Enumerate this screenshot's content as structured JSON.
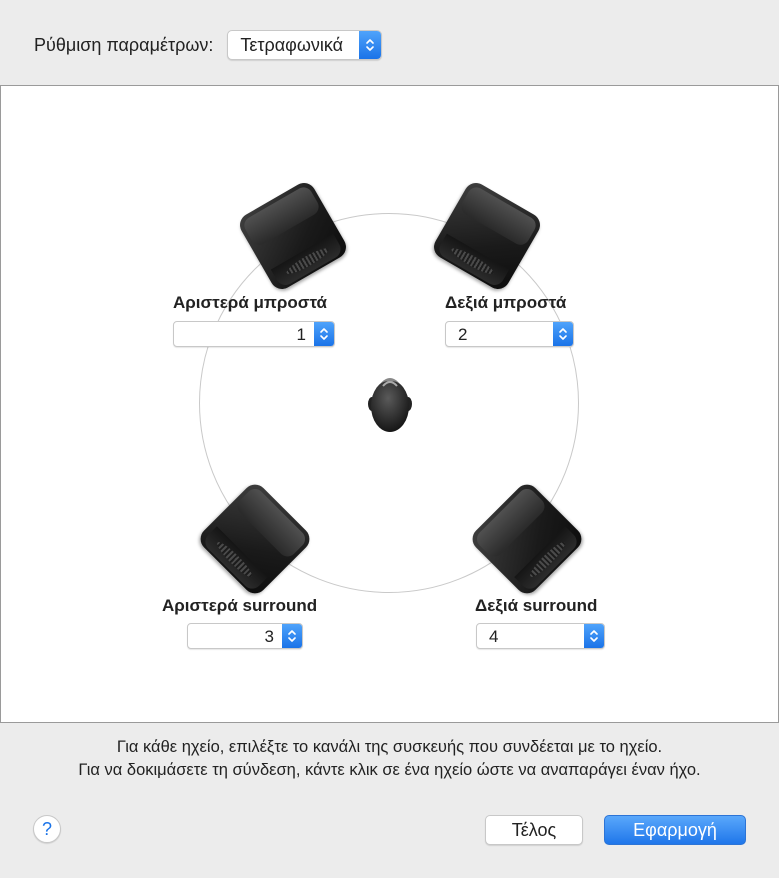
{
  "config": {
    "label": "Ρύθμιση παραμέτρων:",
    "selected": "Τετραφωνικά"
  },
  "speakers": {
    "front_left": {
      "label": "Αριστερά μπροστά",
      "channel": "1"
    },
    "front_right": {
      "label": "Δεξιά μπροστά",
      "channel": "2"
    },
    "surround_left": {
      "label": "Αριστερά surround",
      "channel": "3"
    },
    "surround_right": {
      "label": "Δεξιά surround",
      "channel": "4"
    }
  },
  "instructions": {
    "line1": "Για κάθε ηχείο, επιλέξτε το κανάλι της συσκευής που συνδέεται με το ηχείο.",
    "line2": "Για να δοκιμάσετε τη σύνδεση, κάντε κλικ σε ένα ηχείο ώστε να αναπαράγει έναν ήχο."
  },
  "buttons": {
    "help": "?",
    "done": "Τέλος",
    "apply": "Εφαρμογή"
  },
  "colors": {
    "accent": "#1a73e8",
    "panel_bg": "#ffffff",
    "window_bg": "#ececec"
  }
}
